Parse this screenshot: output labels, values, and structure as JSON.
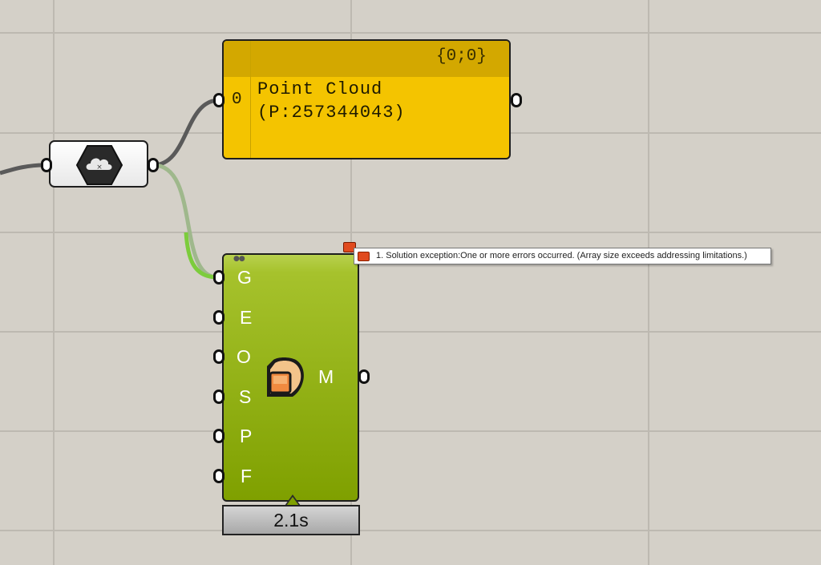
{
  "canvas": {
    "background": "#d4d0c8",
    "grid_color": "#bdb9b1"
  },
  "panel": {
    "header": "{0;0}",
    "index": "0",
    "content": "Point Cloud\n(P:257344043)",
    "color": "#f4c400"
  },
  "source_component": {
    "icon": "point-cloud-hexagon-icon"
  },
  "component": {
    "inputs": [
      "G",
      "E",
      "O",
      "S",
      "P",
      "F"
    ],
    "output": "M",
    "icon": "mesh-from-points-icon",
    "color": "#8fb000",
    "timer": "2.1s"
  },
  "error": {
    "message": "1. Solution exception:One or more errors occurred. (Array size exceeds addressing limitations.)",
    "color": "#e04a1e"
  },
  "wires": {
    "default_color": "#5a5a5a",
    "selected_color": "#7ccc3c"
  }
}
